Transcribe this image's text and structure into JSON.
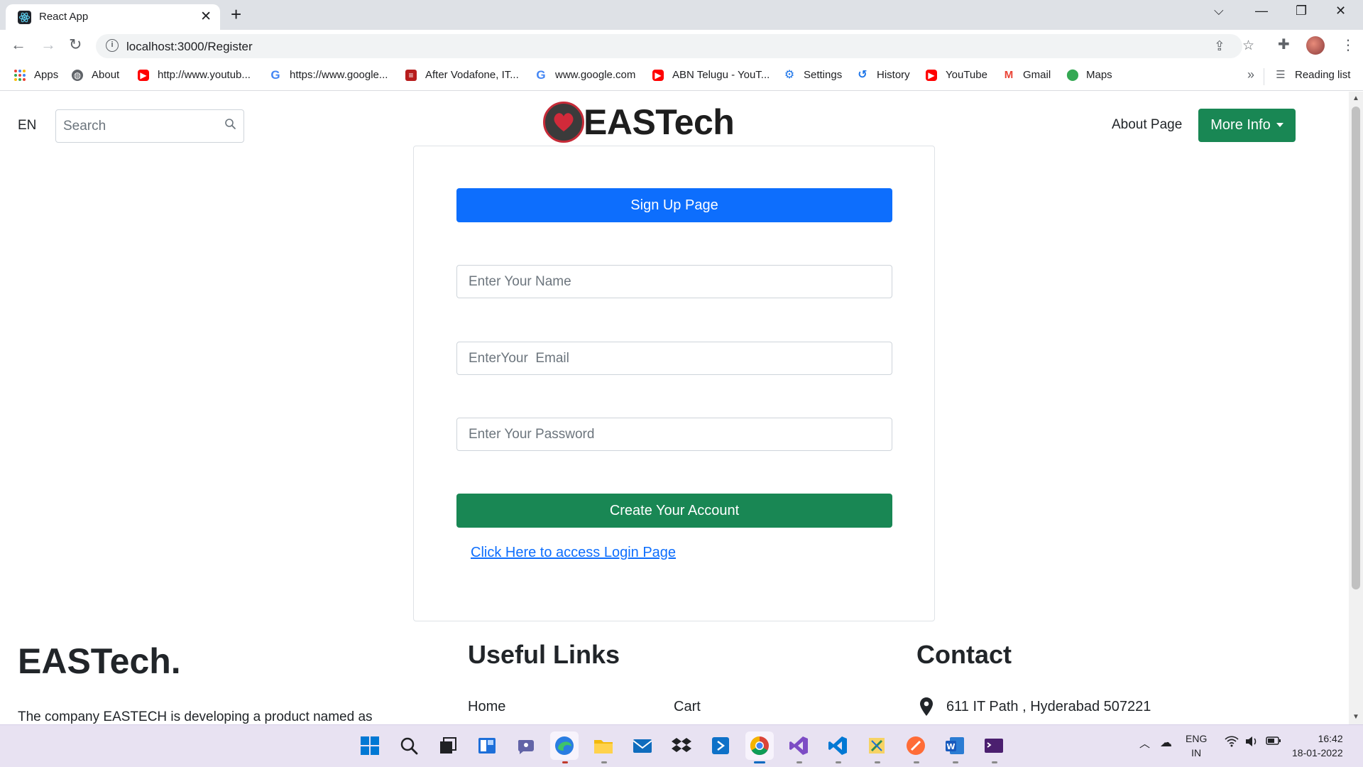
{
  "browser": {
    "tab_title": "React App",
    "url": "localhost:3000/Register",
    "bookmarks": [
      {
        "label": "Apps",
        "icon": "apps-grid-icon"
      },
      {
        "label": "About",
        "icon": "globe-icon"
      },
      {
        "label": "http://www.youtub...",
        "icon": "youtube-icon"
      },
      {
        "label": "https://www.google...",
        "icon": "google-icon"
      },
      {
        "label": "After Vodafone, IT...",
        "icon": "news-icon"
      },
      {
        "label": "www.google.com",
        "icon": "google-icon"
      },
      {
        "label": "ABN Telugu - YouT...",
        "icon": "youtube-icon"
      },
      {
        "label": "Settings",
        "icon": "gear-icon"
      },
      {
        "label": "History",
        "icon": "history-icon"
      },
      {
        "label": "YouTube",
        "icon": "youtube-icon"
      },
      {
        "label": "Gmail",
        "icon": "gmail-icon"
      },
      {
        "label": "Maps",
        "icon": "maps-icon"
      }
    ],
    "more_bookmarks": "»",
    "reading_list": "Reading list"
  },
  "header": {
    "lang": "EN",
    "search_placeholder": "Search",
    "brand": "EASTech",
    "about_link": "About Page",
    "more_info": "More Info"
  },
  "form": {
    "signup_title": "Sign Up Page",
    "name_placeholder": "Enter Your Name",
    "email_placeholder": "EnterYour  Email",
    "password_placeholder": "Enter Your Password",
    "create_button": "Create Your Account",
    "login_link": "Click Here to access Login Page"
  },
  "footer": {
    "brand": "EASTech.",
    "description": "The company EASTECH is developing a product named as",
    "useful_links_title": "Useful Links",
    "links": [
      "Home",
      "Cart"
    ],
    "contact_title": "Contact",
    "address": "611 IT Path , Hyderabad 507221"
  },
  "taskbar": {
    "lang_line1": "ENG",
    "lang_line2": "IN",
    "time": "16:42",
    "date": "18-01-2022"
  },
  "colors": {
    "primary": "#0d6efd",
    "success": "#198754",
    "logo_red": "#c62b38"
  }
}
